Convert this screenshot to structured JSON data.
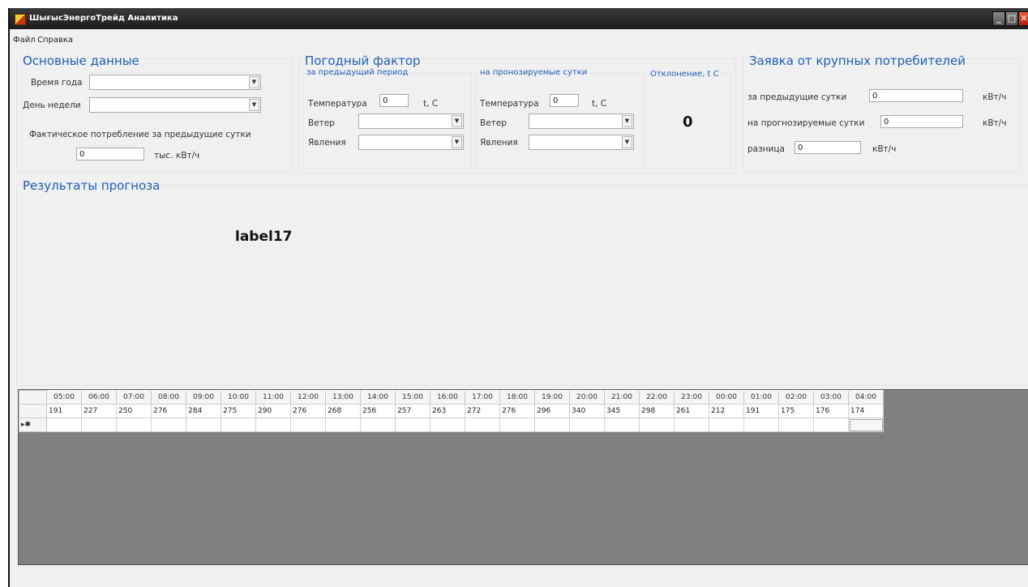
{
  "window": {
    "title": "ШығысЭнергоТрейд Аналитика"
  },
  "menu": {
    "file": "Файл",
    "help": "Справка"
  },
  "main_data": {
    "title": "Основные данные",
    "season_label": "Время года",
    "weekday_label": "День недели",
    "actual_label": "Фактическое потребление за предыдущие сутки",
    "actual_value": "0",
    "actual_unit": "тыс. кВт/ч"
  },
  "weather": {
    "title": "Погодный фактор",
    "prev_period": {
      "title": "за предыдущий период",
      "temp_label": "Температура",
      "temp_value": "0",
      "temp_unit": "t, C",
      "wind_label": "Ветер",
      "phenomena_label": "Явления"
    },
    "forecast_day": {
      "title": "на пронозируемые сутки",
      "temp_label": "Температура",
      "temp_value": "0",
      "temp_unit": "t, C",
      "wind_label": "Ветер",
      "phenomena_label": "Явления"
    },
    "deviation": {
      "title": "Отклонение, t C",
      "value": "0"
    }
  },
  "consumers": {
    "title": "Заявка от крупных потребителей",
    "prev_label": "за предыдущие сутки",
    "prev_value": "0",
    "prev_unit": "кВт/ч",
    "forecast_label": "на прогнозируемые сутки",
    "forecast_value": "0",
    "forecast_unit": "кВт/ч",
    "diff_label": "разница",
    "diff_value": "0",
    "diff_unit": "кВт/ч"
  },
  "results": {
    "title": "Результаты прогноза",
    "label": "label17"
  },
  "grid": {
    "columns": [
      "05:00",
      "06:00",
      "07:00",
      "08:00",
      "09:00",
      "10:00",
      "11:00",
      "12:00",
      "13:00",
      "14:00",
      "15:00",
      "16:00",
      "17:00",
      "18:00",
      "19:00",
      "20:00",
      "21:00",
      "22:00",
      "23:00",
      "00:00",
      "01:00",
      "02:00",
      "03:00",
      "04:00"
    ],
    "values": [
      "191",
      "227",
      "250",
      "276",
      "284",
      "275",
      "290",
      "276",
      "268",
      "256",
      "257",
      "263",
      "272",
      "276",
      "296",
      "340",
      "345",
      "298",
      "261",
      "212",
      "191",
      "175",
      "176",
      "174"
    ],
    "new_row_marker": "▸✱"
  }
}
